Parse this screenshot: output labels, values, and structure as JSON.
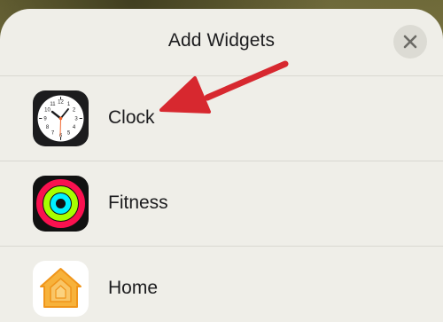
{
  "sheet": {
    "title": "Add Widgets",
    "close_icon": "close-icon"
  },
  "apps": [
    {
      "label": "Clock",
      "icon": "clock-icon"
    },
    {
      "label": "Fitness",
      "icon": "activity-rings-icon"
    },
    {
      "label": "Home",
      "icon": "house-icon"
    }
  ],
  "annotation": {
    "icon": "arrow-pointer-icon",
    "color": "#d7282f"
  },
  "colors": {
    "sheet_bg": "#efeee8",
    "clock_hand_accent": "#f0642c",
    "home_icon_orange": "#f5a623",
    "fitness_move": "#fa114f",
    "fitness_exercise": "#a6ff00",
    "fitness_stand": "#00f0ff"
  }
}
